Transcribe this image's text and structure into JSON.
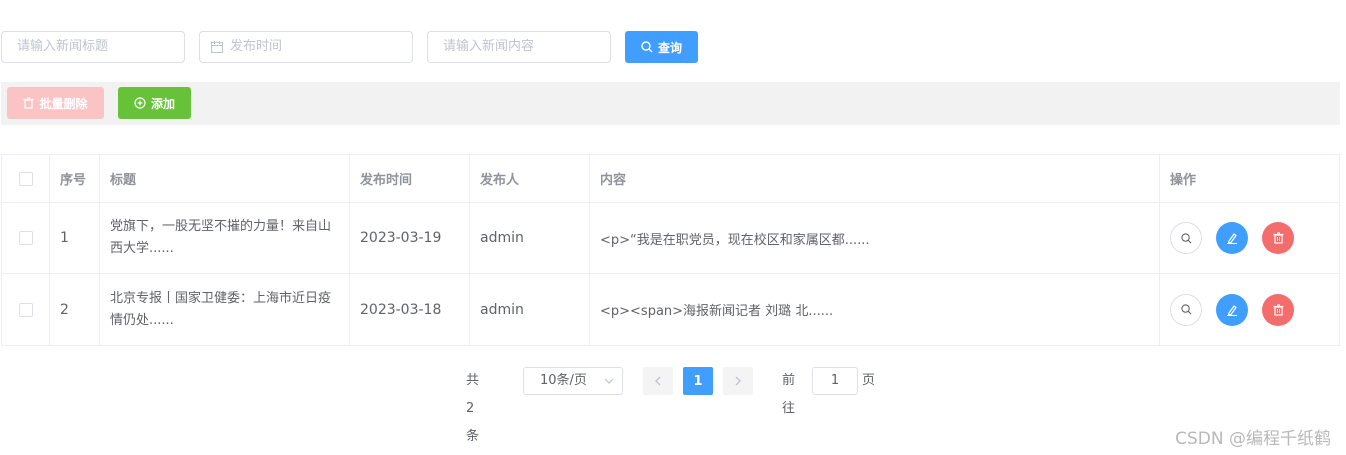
{
  "search": {
    "title_placeholder": "请输入新闻标题",
    "date_placeholder": "发布时间",
    "content_placeholder": "请输入新闻内容",
    "search_label": "查询"
  },
  "toolbar": {
    "batch_delete_label": "批量删除",
    "add_label": "添加"
  },
  "table": {
    "headers": {
      "index": "序号",
      "title": "标题",
      "date": "发布时间",
      "author": "发布人",
      "content": "内容",
      "ops": "操作"
    },
    "rows": [
      {
        "index": "1",
        "title": "党旗下，一股无坚不摧的力量！来自山西大学......",
        "date": "2023-03-19",
        "author": "admin",
        "content": "<p>“我是在职党员，现在校区和家属区都......"
      },
      {
        "index": "2",
        "title": "北京专报丨国家卫健委：上海市近日疫情仍处......",
        "date": "2023-03-18",
        "author": "admin",
        "content": "<p><span>海报新闻记者 刘璐 北......"
      }
    ]
  },
  "pagination": {
    "total": "共 2 条",
    "page_size": "10条/页",
    "current_page": "1",
    "goto_label": "前往",
    "goto_value": "1",
    "page_unit": "页"
  },
  "watermark": "CSDN @编程千纸鹤",
  "colors": {
    "primary": "#409eff",
    "success": "#67c23a",
    "danger": "#f56c6c",
    "danger_light": "#fbc4c4"
  }
}
